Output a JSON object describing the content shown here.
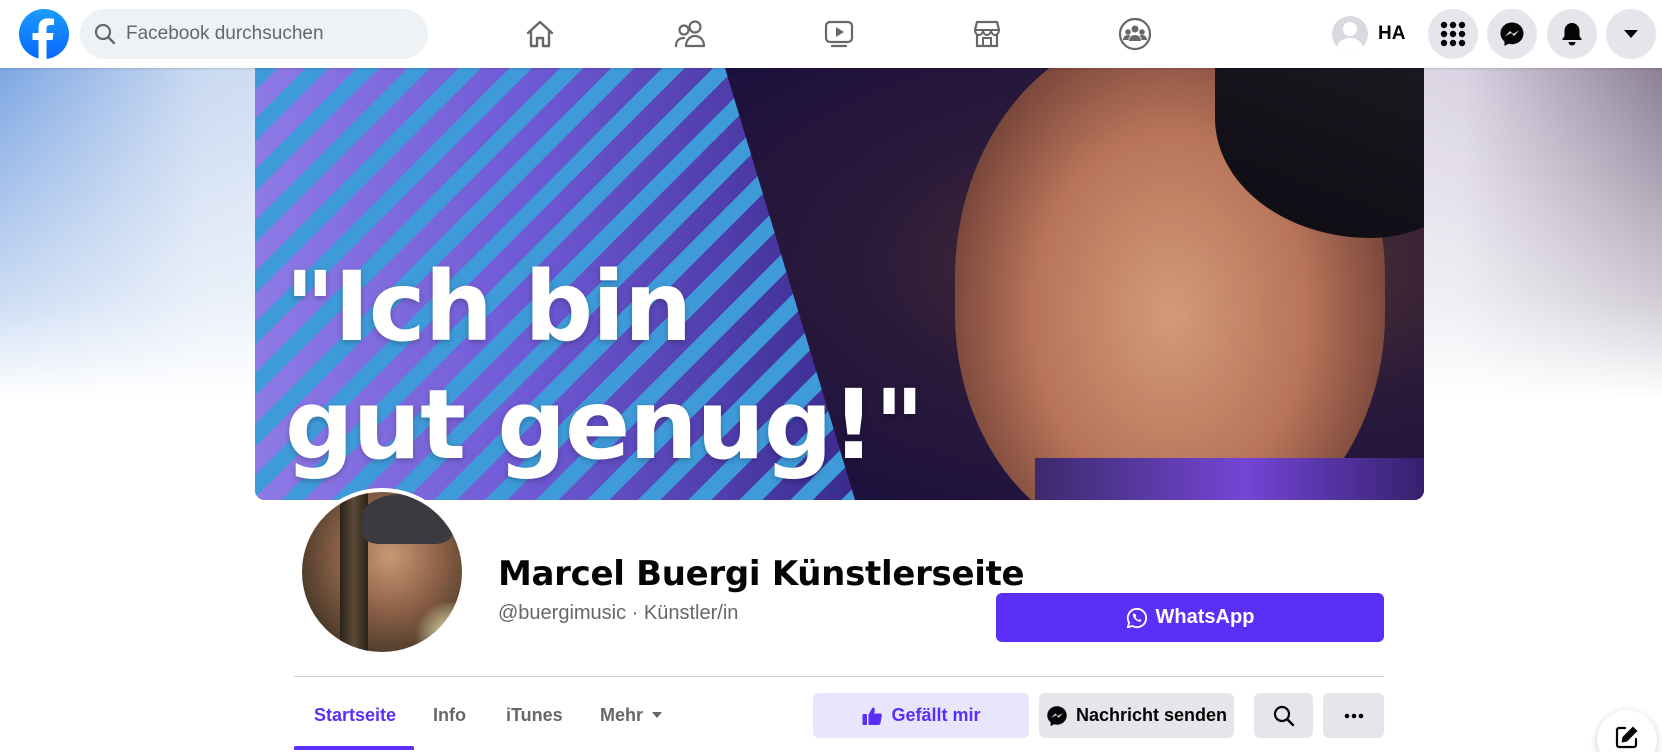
{
  "topbar": {
    "search_placeholder": "Facebook durchsuchen",
    "user_initials": "HA",
    "nav_icons": [
      "home-icon",
      "friends-icon",
      "watch-icon",
      "marketplace-icon",
      "groups-icon"
    ],
    "right_icons": [
      "menu-grid-icon",
      "messenger-icon",
      "notifications-icon",
      "account-dropdown-icon"
    ]
  },
  "cover": {
    "line1": "\"Ich bin",
    "line2": "gut genug!\""
  },
  "page": {
    "name": "Marcel Buergi Künstlerseite",
    "subtitle": "@buergimusic · Künstler/in",
    "whatsapp_label": "WhatsApp"
  },
  "tabs": [
    {
      "label": "Startseite",
      "active": true
    },
    {
      "label": "Info",
      "active": false
    },
    {
      "label": "iTunes",
      "active": false
    },
    {
      "label": "Mehr",
      "active": false
    }
  ],
  "actions": {
    "like_label": "Gefällt mir",
    "message_label": "Nachricht senden"
  },
  "colors": {
    "accent": "#5b2ff7",
    "facebook_blue": "#0866ff",
    "secondary_text": "#65676b",
    "button_gray": "#e4e6eb"
  }
}
